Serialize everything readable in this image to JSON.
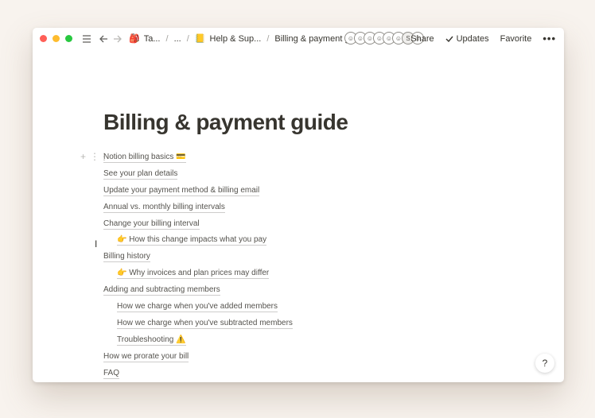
{
  "window": {
    "breadcrumbs": [
      {
        "icon": "🎒",
        "label": "Ta..."
      },
      {
        "icon": "",
        "label": "..."
      },
      {
        "icon": "📒",
        "label": "Help & Sup..."
      },
      {
        "icon": "",
        "label": "Billing & payment g..."
      }
    ],
    "avatars": [
      "☺",
      "☺",
      "☺",
      "☺",
      "☺",
      "☺",
      "S",
      "☺"
    ],
    "actions": {
      "share": "Share",
      "updates": "Updates",
      "favorite": "Favorite",
      "more": "•••"
    }
  },
  "page": {
    "title": "Billing & payment guide",
    "toc": [
      {
        "label": "Notion billing basics 💳",
        "indent": false
      },
      {
        "label": "See your plan details",
        "indent": false
      },
      {
        "label": "Update your payment method & billing email",
        "indent": false
      },
      {
        "label": "Annual vs. monthly billing intervals",
        "indent": false
      },
      {
        "label": "Change your billing interval",
        "indent": false
      },
      {
        "label": "👉 How this change impacts what you pay",
        "indent": true
      },
      {
        "label": "Billing history",
        "indent": false
      },
      {
        "label": "👉 Why invoices and plan prices may differ",
        "indent": true
      },
      {
        "label": "Adding and subtracting members",
        "indent": false
      },
      {
        "label": "How we charge when you've added members",
        "indent": true
      },
      {
        "label": "How we charge when you've subtracted members",
        "indent": true
      },
      {
        "label": "Troubleshooting ⚠️",
        "indent": true
      },
      {
        "label": "How we prorate your bill",
        "indent": false
      },
      {
        "label": "FAQ",
        "indent": false
      }
    ]
  },
  "help": {
    "label": "?"
  }
}
